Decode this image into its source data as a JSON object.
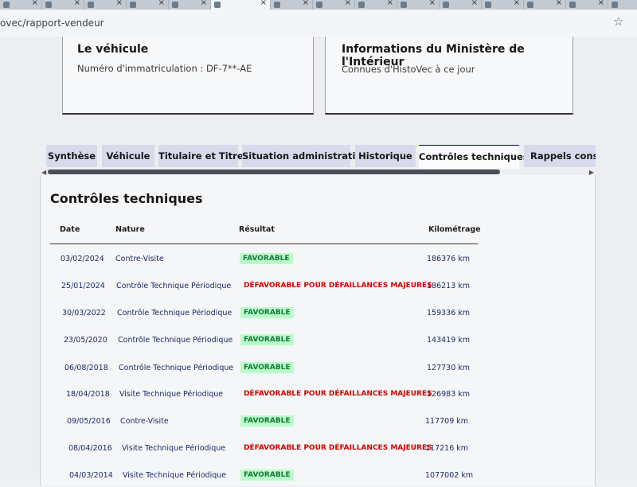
{
  "browser": {
    "url": "ovec/rapport-vendeur"
  },
  "vehicle_card": {
    "title": "Le véhicule",
    "plate_line": "Numéro d'immatriculation : DF-7**-AE"
  },
  "ministry_card": {
    "title": "Informations du Ministère de l'Intérieur",
    "subtitle": "Connues d'HistoVec à ce jour"
  },
  "tabs": [
    {
      "label": "Synthèse",
      "active": false
    },
    {
      "label": "Véhicule",
      "active": false
    },
    {
      "label": "Titulaire et Titre",
      "active": false
    },
    {
      "label": "Situation administrative",
      "active": false
    },
    {
      "label": "Historique",
      "active": false
    },
    {
      "label": "Contrôles techniques",
      "active": true
    },
    {
      "label": "Rappels constru",
      "active": false
    }
  ],
  "section": {
    "title": "Contrôles techniques",
    "headers": {
      "date": "Date",
      "nature": "Nature",
      "result": "Résultat",
      "mileage": "Kilométrage"
    },
    "rows": [
      {
        "date": "03/02/2024",
        "nature": "Contre-Visite",
        "result": "FAVORABLE",
        "status": "ok",
        "km": "186376 km"
      },
      {
        "date": "25/01/2024",
        "nature": "Contrôle Technique Périodique",
        "result": "DÉFAVORABLE POUR DÉFAILLANCES MAJEURES",
        "status": "ko",
        "km": "186213 km"
      },
      {
        "date": "30/03/2022",
        "nature": "Contrôle Technique Périodique",
        "result": "FAVORABLE",
        "status": "ok",
        "km": "159336 km"
      },
      {
        "date": "23/05/2020",
        "nature": "Contrôle Technique Périodique",
        "result": "FAVORABLE",
        "status": "ok",
        "km": "143419 km"
      },
      {
        "date": "06/08/2018",
        "nature": "Contrôle Technique Périodique",
        "result": "FAVORABLE",
        "status": "ok",
        "km": "127730 km"
      },
      {
        "date": "18/04/2018",
        "nature": "Visite Technique Périodique",
        "result": "DÉFAVORABLE POUR DÉFAILLANCES MAJEURES",
        "status": "ko",
        "km": "126983 km"
      },
      {
        "date": "09/05/2016",
        "nature": "Contre-Visite",
        "result": "FAVORABLE",
        "status": "ok",
        "km": "117709 km"
      },
      {
        "date": "08/04/2016",
        "nature": "Visite Technique Périodique",
        "result": "DÉFAVORABLE POUR DÉFAILLANCES MAJEURES",
        "status": "ko",
        "km": "117216 km"
      },
      {
        "date": "04/03/2014",
        "nature": "Visite Technique Périodique",
        "result": "FAVORABLE",
        "status": "ok",
        "km": "1077002 km"
      }
    ]
  },
  "colors": {
    "accent": "#000091",
    "success_bg": "#b8fec9",
    "success_text": "#18753c",
    "error_text": "#ce0500",
    "tab_bg": "#d7daeb"
  },
  "icons": {
    "bookmark": "star-icon",
    "scroll_left": "arrow-left-icon",
    "scroll_right": "arrow-right-icon"
  }
}
